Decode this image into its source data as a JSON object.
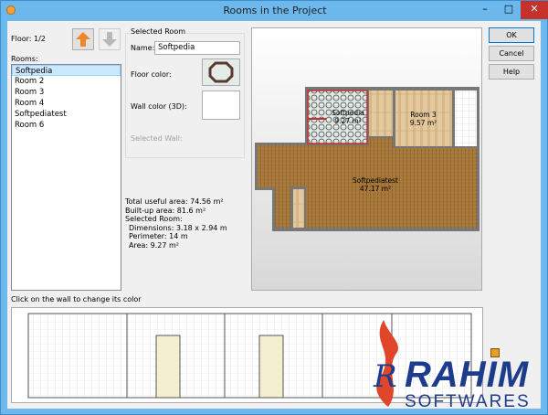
{
  "window": {
    "title": "Rooms in the Project",
    "minimize": "–",
    "maximize": "□",
    "close": "✕",
    "accent": "#6cb8ec"
  },
  "floor": {
    "label": "Floor: 1/2",
    "up_icon": "arrow-up-icon",
    "down_icon": "arrow-down-icon"
  },
  "rooms": {
    "label": "Rooms:",
    "items": [
      "Softpedia",
      "Room 2",
      "Room 3",
      "Room 4",
      "Softpediatest",
      "Room 6"
    ],
    "selected": "Softpedia"
  },
  "selected_room": {
    "group_title": "Selected Room",
    "name_label": "Name:",
    "name_value": "Softpedia",
    "floor_color_label": "Floor color:",
    "wall_color_label": "Wall color (3D):",
    "selected_wall_label": "Selected Wall:"
  },
  "stats": {
    "total_useful_area": "Total useful area: 74.56 m²",
    "built_up_area": "Built-up area: 81.6 m²",
    "selected_room": "Selected Room:",
    "dimensions": "Dimensions: 3.18 x 2.94 m",
    "perimeter": "Perimeter: 14 m",
    "area": "Area: 9.27 m²"
  },
  "plan": {
    "rooms": [
      {
        "name": "Softpedia",
        "area": "9.27 m²"
      },
      {
        "name": "Room 3",
        "area": "9.57 m²"
      },
      {
        "name": "Softpediatest",
        "area": "47.17 m²"
      }
    ]
  },
  "buttons": {
    "ok": "OK",
    "cancel": "Cancel",
    "help": "Help"
  },
  "hint": "Click on the wall to change its color",
  "watermark": {
    "line1": "RAHIM",
    "line2": "SOFTWARES"
  }
}
